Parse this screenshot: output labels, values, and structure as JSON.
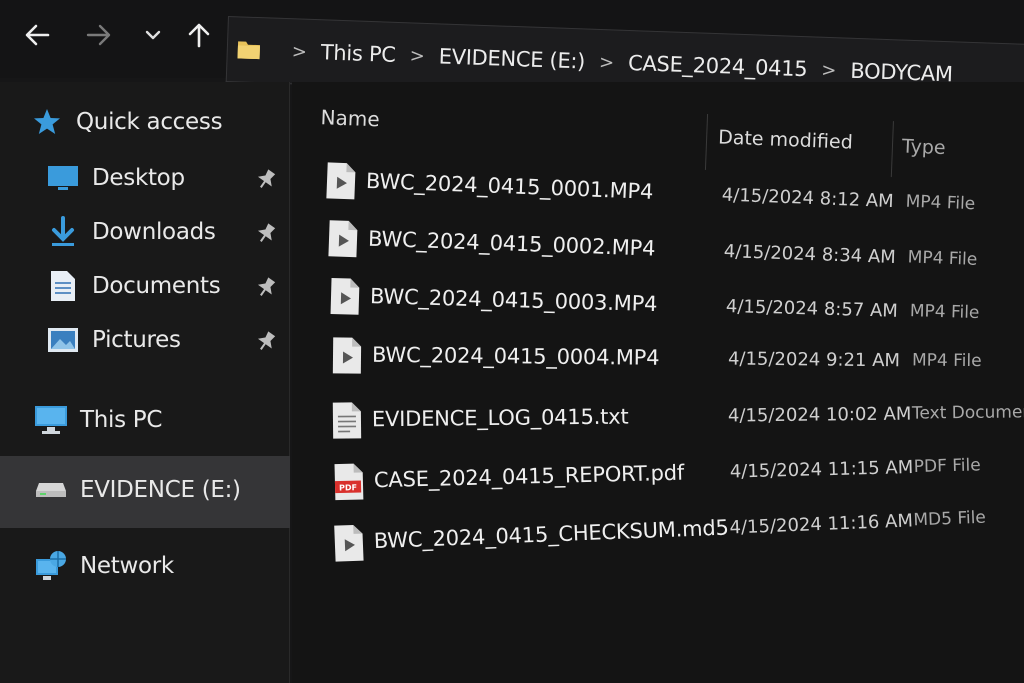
{
  "navigation": {
    "back_icon": "arrow-left-icon",
    "forward_icon": "arrow-right-icon",
    "recent_icon": "chevron-down-icon",
    "up_icon": "arrow-up-icon"
  },
  "breadcrumb": {
    "items": [
      "This PC",
      "EVIDENCE (E:)",
      "CASE_2024_0415",
      "BODYCAM"
    ],
    "separator": ">"
  },
  "sidebar": {
    "items": [
      {
        "label": "Quick access",
        "icon": "star-icon",
        "pinned": false
      },
      {
        "label": "Desktop",
        "icon": "desktop-icon",
        "pinned": true
      },
      {
        "label": "Downloads",
        "icon": "download-icon",
        "pinned": true
      },
      {
        "label": "Documents",
        "icon": "document-icon",
        "pinned": true
      },
      {
        "label": "Pictures",
        "icon": "pictures-icon",
        "pinned": true
      },
      {
        "label": "This PC",
        "icon": "computer-icon",
        "pinned": false
      },
      {
        "label": "EVIDENCE (E:)",
        "icon": "drive-icon",
        "pinned": false,
        "selected": true
      },
      {
        "label": "Network",
        "icon": "network-icon",
        "pinned": false
      }
    ]
  },
  "files": {
    "columns": {
      "name": "Name",
      "date": "Date modified",
      "type": "Type"
    },
    "rows": [
      {
        "name": "BWC_2024_0415_0001.MP4",
        "date": "4/15/2024  8:12 AM",
        "type": "MP4 File",
        "icon": "video-file-icon"
      },
      {
        "name": "BWC_2024_0415_0002.MP4",
        "date": "4/15/2024  8:34 AM",
        "type": "MP4 File",
        "icon": "video-file-icon"
      },
      {
        "name": "BWC_2024_0415_0003.MP4",
        "date": "4/15/2024  8:57 AM",
        "type": "MP4 File",
        "icon": "video-file-icon"
      },
      {
        "name": "BWC_2024_0415_0004.MP4",
        "date": "4/15/2024  9:21 AM",
        "type": "MP4 File",
        "icon": "video-file-icon"
      },
      {
        "name": "EVIDENCE_LOG_0415.txt",
        "date": "4/15/2024  10:02 AM",
        "type": "Text Document",
        "icon": "text-file-icon"
      },
      {
        "name": "CASE_2024_0415_REPORT.pdf",
        "date": "4/15/2024  11:15 AM",
        "type": "PDF File",
        "icon": "pdf-file-icon",
        "badge": "PDF"
      },
      {
        "name": "BWC_2024_0415_CHECKSUM.md5",
        "date": "4/15/2024  11:16 AM",
        "type": "MD5 File",
        "icon": "video-file-icon"
      }
    ]
  },
  "colors": {
    "accent_blue": "#3a9bdc",
    "folder_yellow": "#e8c25a",
    "pdf_red": "#d9302c",
    "selected_bg": "#353537"
  }
}
